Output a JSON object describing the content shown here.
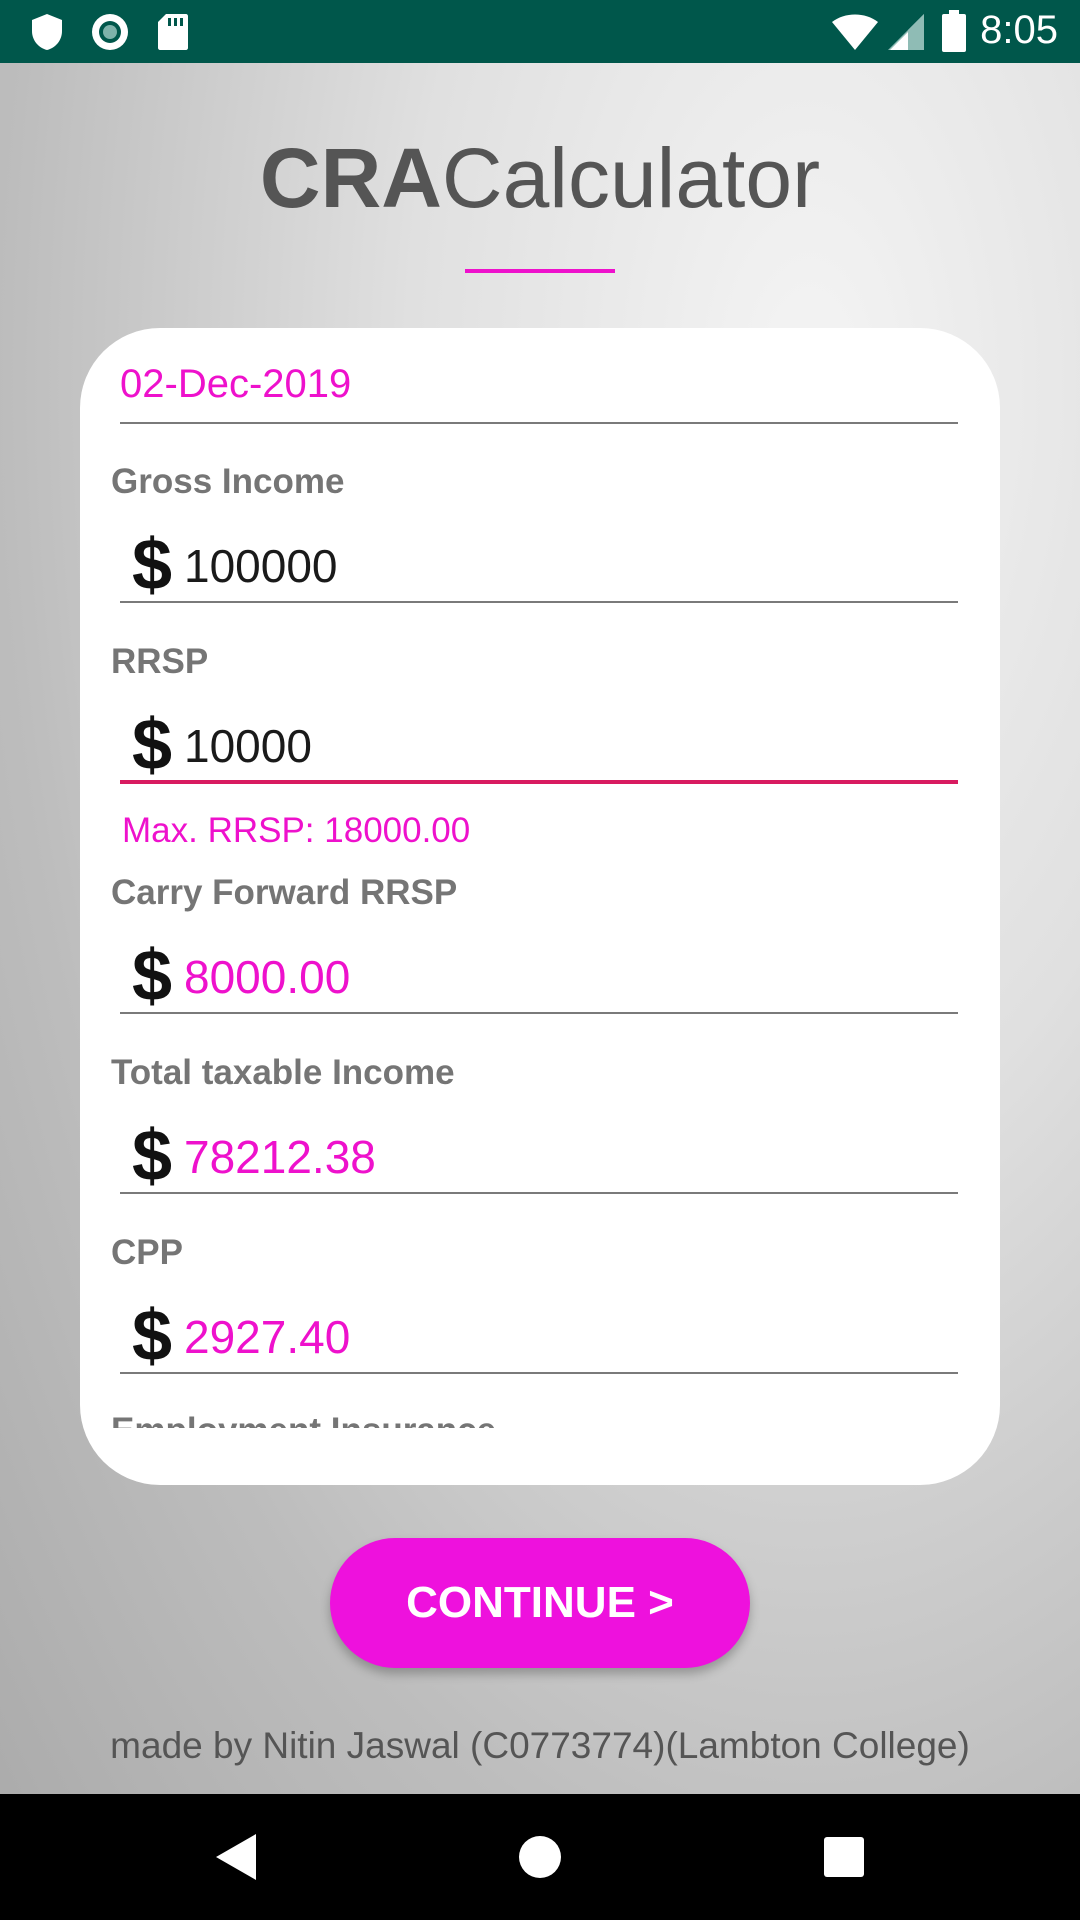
{
  "status_bar": {
    "time": "8:05",
    "left_icons": [
      "shield-icon",
      "record-icon",
      "sd-card-icon"
    ],
    "right_icons": [
      "wifi-icon",
      "signal-icon",
      "battery-icon"
    ],
    "color": "#00574b"
  },
  "app": {
    "title_bold": "CRA",
    "title_regular": "Calculator",
    "accent_color": "#ee11cc"
  },
  "form": {
    "date_value": "02-Dec-2019",
    "currency_symbol": "$",
    "fields": [
      {
        "label": "Gross Income",
        "value": "100000"
      },
      {
        "label": "RRSP",
        "value": "10000",
        "hint": "Max. RRSP: 18000.00"
      },
      {
        "label": "Carry Forward RRSP",
        "value": "8000.00"
      },
      {
        "label": "Total taxable Income",
        "value": "78212.38"
      },
      {
        "label": "CPP",
        "value": "2927.40"
      },
      {
        "label": "Employment Insurance"
      }
    ]
  },
  "continue_button": {
    "label": "CONTINUE >"
  },
  "footer": {
    "text": "made by Nitin Jaswal (C0773774)(Lambton College)"
  },
  "nav_bar": {
    "buttons": [
      "back-icon",
      "home-icon",
      "recents-icon"
    ]
  }
}
